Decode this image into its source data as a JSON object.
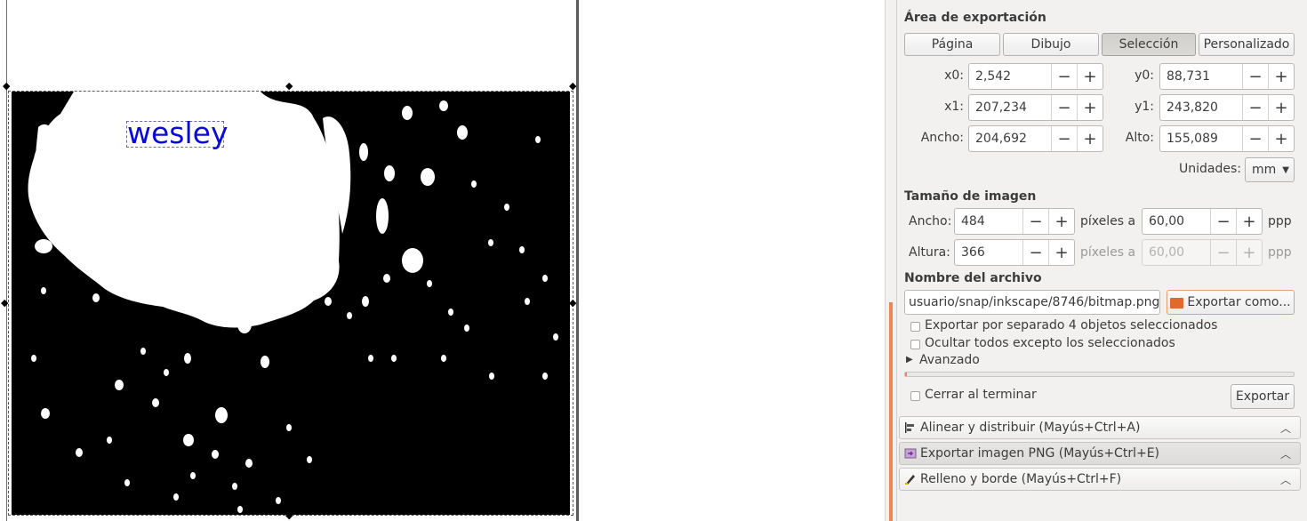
{
  "canvas": {
    "text_object": "wesley",
    "colors": {
      "text": "#0a0add",
      "image_bg": "#000000",
      "splash": "#ffffff"
    }
  },
  "export": {
    "area_title": "Área de exportación",
    "area_buttons": [
      "Página",
      "Dibujo",
      "Selección",
      "Personalizado"
    ],
    "area_selected": "Selección",
    "coords": {
      "x0_label": "x0:",
      "x0": "2,542",
      "y0_label": "y0:",
      "y0": "88,731",
      "x1_label": "x1:",
      "x1": "207,234",
      "y1_label": "y1:",
      "y1": "243,820",
      "width_label": "Ancho:",
      "width": "204,692",
      "height_label": "Alto:",
      "height": "155,089"
    },
    "units_label": "Unidades:",
    "units_value": "mm",
    "image_size_title": "Tamaño de imagen",
    "img_width_label": "Ancho:",
    "img_width": "484",
    "img_height_label": "Altura:",
    "img_height": "366",
    "pixels_at": "píxeles a",
    "dpi": "60,00",
    "dpi2": "60,00",
    "dpi_unit": "ppp",
    "filename_title": "Nombre del archivo",
    "filename": "usuario/snap/inkscape/8746/bitmap.png",
    "export_as_label": "Exportar como...",
    "batch_label": "Exportar por separado 4 objetos seleccionados",
    "hide_label": "Ocultar todos excepto los seleccionados",
    "advanced_label": "Avanzado",
    "close_label": "Cerrar al terminar",
    "export_button": "Exportar",
    "progress": 0.0
  },
  "docks": [
    {
      "label": "Alinear y distribuir (Mayús+Ctrl+A)",
      "icon": "align-icon"
    },
    {
      "label": "Exportar imagen PNG (Mayús+Ctrl+E)",
      "icon": "export-png-icon"
    },
    {
      "label": "Relleno y borde (Mayús+Ctrl+F)",
      "icon": "fill-stroke-icon"
    }
  ],
  "colors": {
    "accent": "#e8875a",
    "panel_bg": "#f2f1f0"
  }
}
